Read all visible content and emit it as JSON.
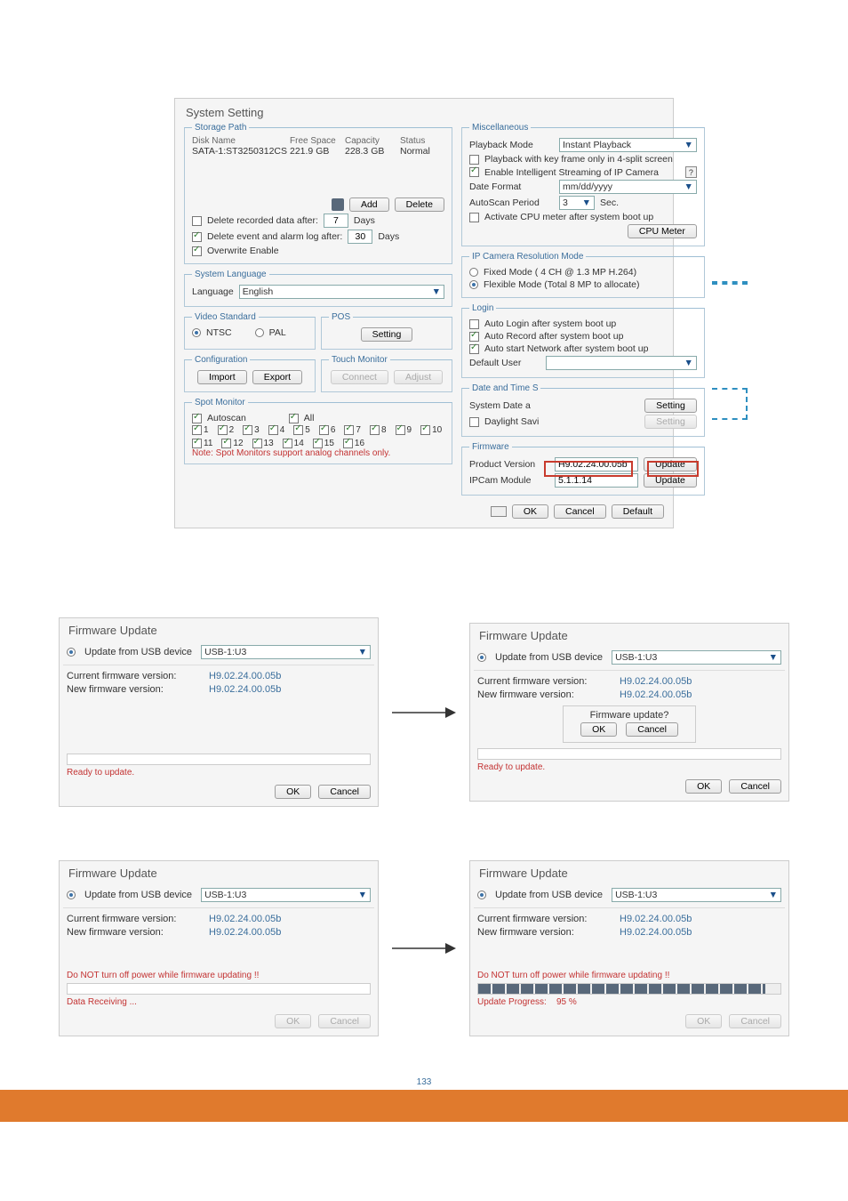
{
  "page_number": "133",
  "sys": {
    "title": "System Setting",
    "storage": {
      "legend": "Storage Path",
      "headers": {
        "name": "Disk Name",
        "free": "Free Space",
        "cap": "Capacity",
        "status": "Status"
      },
      "disk": {
        "name": "SATA-1:ST3250312CS",
        "free": "221.9 GB",
        "cap": "228.3 GB",
        "status": "Normal"
      },
      "add_btn": "Add",
      "delete_btn": "Delete",
      "del_after_chk": "Delete recorded data after:",
      "del_after_val": "7",
      "del_after_unit": "Days",
      "del_evt_chk": "Delete event and alarm log after:",
      "del_evt_val": "30",
      "del_evt_unit": "Days",
      "overwrite": "Overwrite Enable"
    },
    "lang": {
      "legend": "System Language",
      "label": "Language",
      "value": "English"
    },
    "video": {
      "legend": "Video Standard",
      "ntsc": "NTSC",
      "pal": "PAL"
    },
    "pos": {
      "legend": "POS",
      "setting": "Setting"
    },
    "config": {
      "legend": "Configuration",
      "import_btn": "Import",
      "export_btn": "Export"
    },
    "touch": {
      "legend": "Touch Monitor",
      "connect": "Connect",
      "adjust": "Adjust"
    },
    "spot": {
      "legend": "Spot Monitor",
      "autoscan": "Autoscan",
      "all": "All",
      "ids": [
        "1",
        "2",
        "3",
        "4",
        "5",
        "6",
        "7",
        "8",
        "9",
        "10",
        "11",
        "12",
        "13",
        "14",
        "15",
        "16"
      ],
      "note": "Note: Spot Monitors support analog channels only."
    },
    "misc": {
      "legend": "Miscellaneous",
      "pb_mode_lbl": "Playback Mode",
      "pb_mode_val": "Instant Playback",
      "pb_key_frame": "Playback with key frame only in 4-split screen",
      "enable_ip_stream": "Enable Intelligent Streaming of IP Camera",
      "date_fmt_lbl": "Date Format",
      "date_fmt_val": "mm/dd/yyyy",
      "autoscan_lbl": "AutoScan Period",
      "autoscan_val": "3",
      "autoscan_unit": "Sec.",
      "cpu_chk": "Activate CPU meter after system boot up",
      "cpu_btn": "CPU Meter"
    },
    "ipres": {
      "legend": "IP Camera Resolution Mode",
      "fixed": "Fixed Mode ( 4 CH @ 1.3 MP H.264)",
      "flex": "Flexible Mode (Total 8 MP to allocate)"
    },
    "login": {
      "legend": "Login",
      "auto_login": "Auto Login after system boot up",
      "auto_record": "Auto Record after system boot up",
      "auto_net": "Auto start Network after system boot up",
      "def_user_lbl": "Default User",
      "def_user_val": ""
    },
    "date": {
      "legend": "Date and Time S",
      "sys_date": "System Date a",
      "btn": "Setting",
      "daylight": "Daylight Savi",
      "btn2": "Setting"
    },
    "fw": {
      "legend": "Firmware",
      "prod_lbl": "Product Version",
      "prod_val": "H9.02.24.00.05b",
      "update_btn": "Update",
      "ipcam_lbl": "IPCam Module",
      "ipcam_val": "5.1.1.14"
    },
    "footer": {
      "ok": "OK",
      "cancel": "Cancel",
      "default": "Default"
    }
  },
  "fw_common": {
    "title": "Firmware Update",
    "update_usb": "Update from USB device",
    "usb_val": "USB-1:U3",
    "current_lbl": "Current firmware version:",
    "new_lbl": "New firmware version:",
    "current_val": "H9.02.24.00.05b",
    "new_val": "H9.02.24.00.05b",
    "ok": "OK",
    "cancel": "Cancel"
  },
  "fw_p1": {
    "status": "Ready to update."
  },
  "fw_p2": {
    "status": "Ready to update.",
    "confirm_title": "Firmware update?",
    "confirm_ok": "OK",
    "confirm_cancel": "Cancel"
  },
  "fw_p3": {
    "warn": "Do NOT turn off power while firmware updating !!",
    "status": "Data Receiving ..."
  },
  "fw_p4": {
    "warn": "Do NOT turn off power while firmware updating !!",
    "progress_lbl": "Update Progress:",
    "progress_val": "95 %"
  }
}
